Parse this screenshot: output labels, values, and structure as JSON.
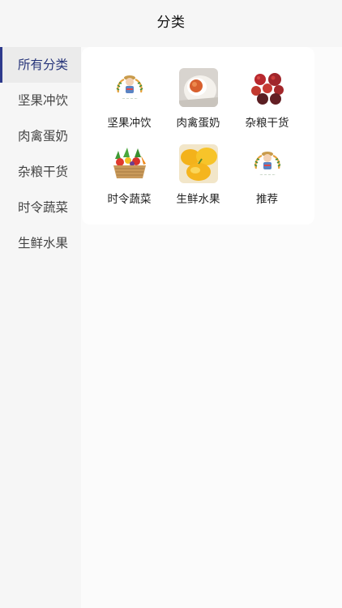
{
  "header": {
    "title": "分类"
  },
  "sidebar": {
    "items": [
      {
        "label": "所有分类",
        "active": true
      },
      {
        "label": "坚果冲饮",
        "active": false
      },
      {
        "label": "肉禽蛋奶",
        "active": false
      },
      {
        "label": "杂粮干货",
        "active": false
      },
      {
        "label": "时令蔬菜",
        "active": false
      },
      {
        "label": "生鲜水果",
        "active": false
      }
    ]
  },
  "categories": [
    {
      "label": "坚果冲饮",
      "icon": "farm-logo-icon"
    },
    {
      "label": "肉禽蛋奶",
      "icon": "salted-egg-image"
    },
    {
      "label": "杂粮干货",
      "icon": "red-dates-image"
    },
    {
      "label": "时令蔬菜",
      "icon": "vegetable-basket-image"
    },
    {
      "label": "生鲜水果",
      "icon": "mango-image"
    },
    {
      "label": "推荐",
      "icon": "farm-logo-icon"
    }
  ],
  "colors": {
    "accent": "#2d3a8c",
    "active_bg": "#ebebeb",
    "page_bg": "#f6f6f6"
  }
}
